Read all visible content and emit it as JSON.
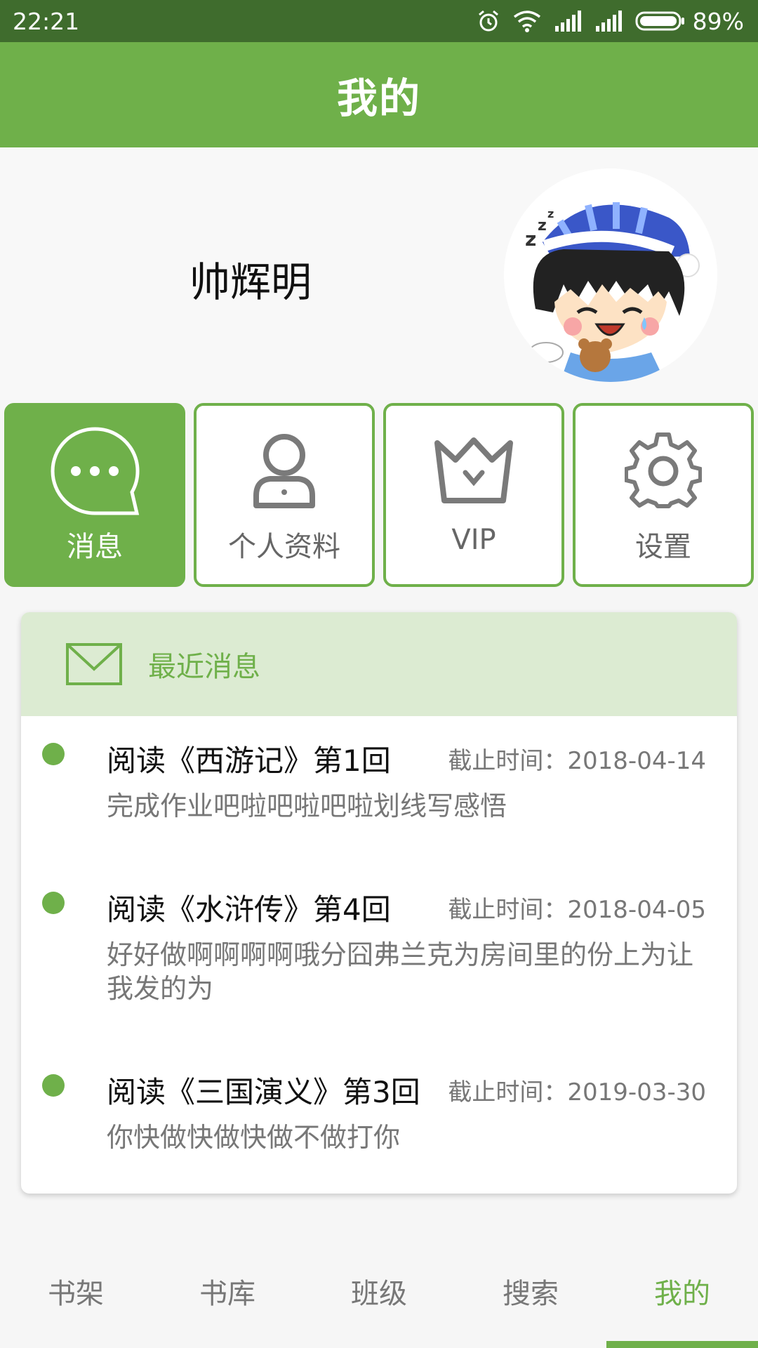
{
  "status_bar": {
    "time": "22:21",
    "battery": "89%",
    "icons": [
      "alarm-icon",
      "wifi-icon",
      "signal-icon",
      "signal-icon",
      "battery-icon"
    ]
  },
  "header": {
    "title": "我的"
  },
  "profile": {
    "name": "帅辉明",
    "avatar": "avatar-image"
  },
  "tiles": [
    {
      "label": "消息",
      "icon": "chat-icon",
      "active": true
    },
    {
      "label": "个人资料",
      "icon": "person-icon",
      "active": false
    },
    {
      "label": "VIP",
      "icon": "crown-icon",
      "active": false
    },
    {
      "label": "设置",
      "icon": "gear-icon",
      "active": false
    }
  ],
  "messages": {
    "header": "最近消息",
    "icon": "mail-icon",
    "items": [
      {
        "title": "阅读《西游记》第1回",
        "deadline": "截止时间：2018-04-14",
        "body": "完成作业吧啦吧啦吧啦划线写感悟"
      },
      {
        "title": "阅读《水浒传》第4回",
        "deadline": "截止时间：2018-04-05",
        "body": "好好做啊啊啊啊哦分囧弗兰克为房间里的份上为让我发的为"
      },
      {
        "title": "阅读《三国演义》第3回",
        "deadline": "截止时间：2019-03-30",
        "body": "你快做快做快做不做打你"
      }
    ]
  },
  "bottom_nav": {
    "items": [
      "书架",
      "书库",
      "班级",
      "搜索",
      "我的"
    ],
    "active_index": 4
  },
  "colors": {
    "primary": "#6fb04a",
    "status_bar": "#3f6c2d",
    "card_header": "#dcebd2"
  }
}
